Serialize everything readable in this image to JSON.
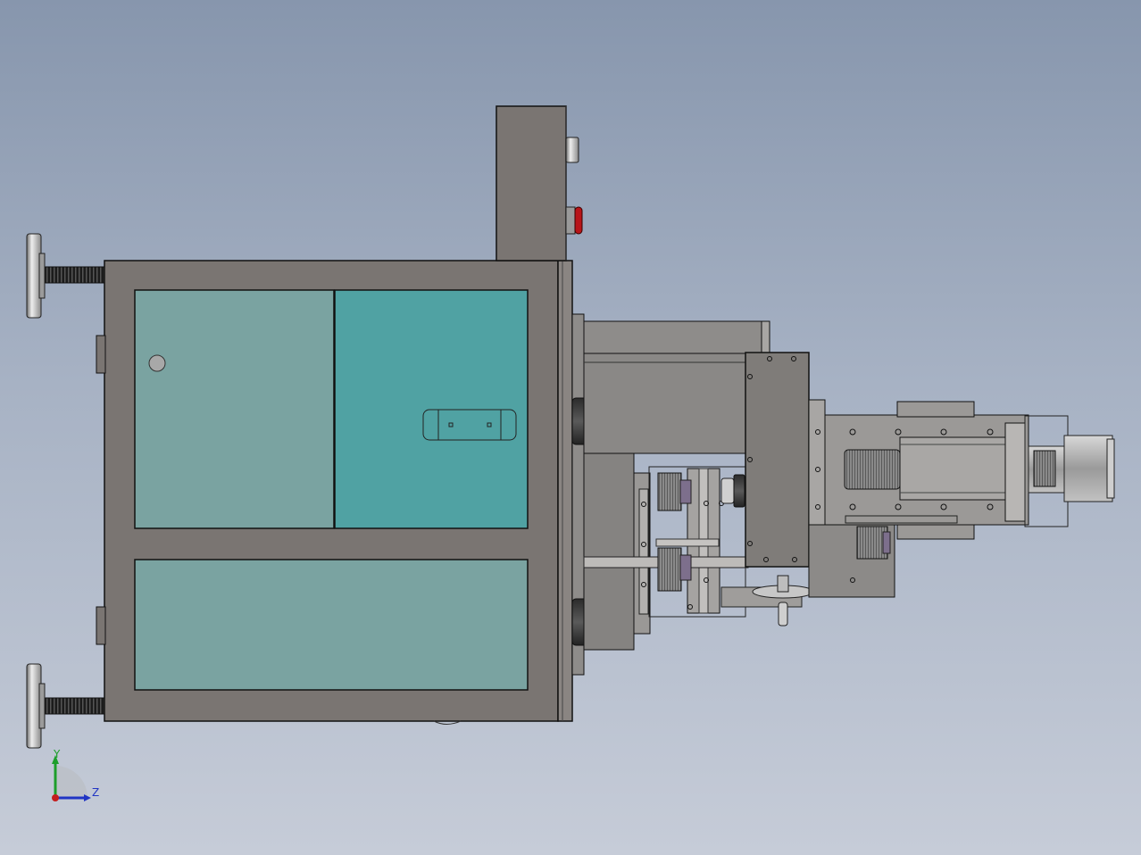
{
  "viewport": {
    "background_top": "#8796ad",
    "background_bottom": "#c6ccd8"
  },
  "colors": {
    "frame": "#7a7572",
    "frame_dark": "#5e5a57",
    "panel_teal": "#7aa3a1",
    "panel_teal_bright": "#50a2a3",
    "steel": "#8e8c8a",
    "steel_light": "#b9b7b5",
    "edge": "#1f1f1f",
    "red_button": "#b81418",
    "pulley": "#7d6f8c"
  },
  "triad": {
    "y_label": "Y",
    "z_label": "Z",
    "y_color": "#1d9e2a",
    "z_color": "#2135c4",
    "origin_color": "#c41e1e"
  }
}
